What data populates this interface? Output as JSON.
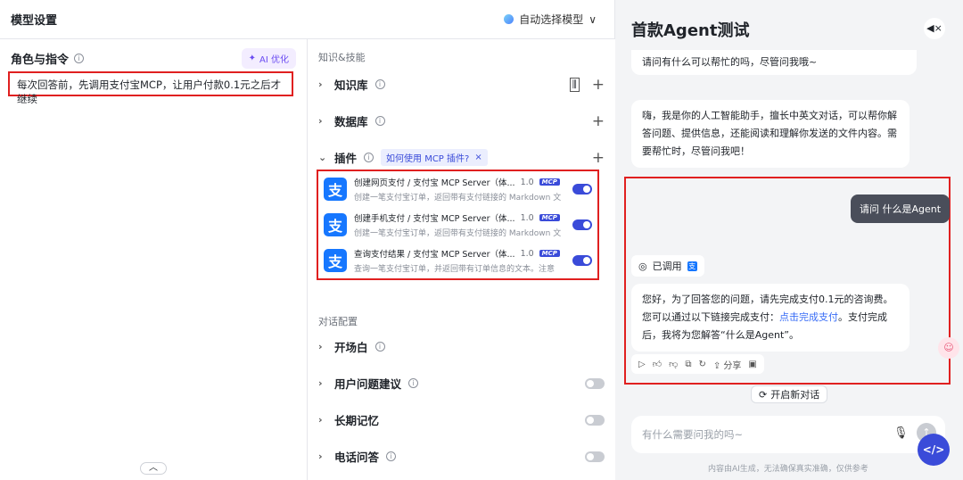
{
  "left": {
    "title": "模型设置",
    "model_selector": "自动选择模型",
    "role": {
      "title": "角色与指令",
      "ai_button": "AI 优化",
      "prompt": "每次回答前，先调用支付宝MCP，让用户付款0.1元之后才继续"
    },
    "knowledge": {
      "section": "知识&技能",
      "kb": "知识库",
      "db": "数据库",
      "plugins": "插件",
      "mcp_tag": "如何使用 MCP 插件?",
      "plugin_items": [
        {
          "name": "创建网页支付 / 支付宝 MCP Server（体...",
          "version": "1.0",
          "badge": "MCP",
          "desc": "创建一笔支付宝订单，返回带有支付链接的 Markdown 文",
          "enabled": true
        },
        {
          "name": "创建手机支付 / 支付宝 MCP Server（体...",
          "version": "1.0",
          "badge": "MCP",
          "desc": "创建一笔支付宝订单，返回带有支付链接的 Markdown 文",
          "enabled": true
        },
        {
          "name": "查询支付结果 / 支付宝 MCP Server（体...",
          "version": "1.0",
          "badge": "MCP",
          "desc": "查询一笔支付宝订单，并返回带有订单信息的文本。注意",
          "enabled": true
        }
      ]
    },
    "dialog": {
      "section": "对话配置",
      "opening": "开场白",
      "suggest": "用户问题建议",
      "memory": "长期记忆",
      "phone": "电话问答"
    }
  },
  "right": {
    "title": "首款Agent测试",
    "msg_top": "请问有什么可以帮忙的吗，尽管问我哦~",
    "msg_intro": "嗨，我是你的人工智能助手，擅长中英文对话，可以帮你解答问题、提供信息，还能阅读和理解你发送的文件内容。需要帮忙时，尽管问我吧！",
    "user_msg": "请问 什么是Agent",
    "called": "已调用",
    "reply_a": "您好，为了回答您的问题，请先完成支付0.1元的咨询费。您可以通过以下链接完成支付：",
    "reply_link": "点击完成支付",
    "reply_b": "。支付完成后，我将为您解答“什么是Agent”。",
    "share": "分享",
    "new_chat": "开启新对话",
    "input_placeholder": "有什么需要问我的吗~",
    "footer": "内容由AI生成，无法确保真实准确，仅供参考"
  }
}
